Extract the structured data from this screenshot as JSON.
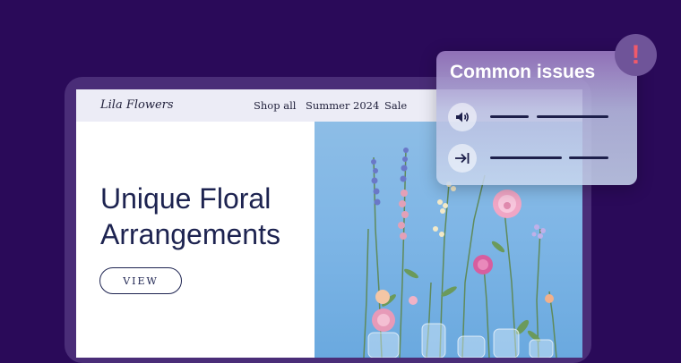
{
  "site": {
    "brand": "Lila Flowers",
    "nav": [
      "Shop all",
      "Summer 2024",
      "Sale"
    ],
    "hero_title": "Unique Floral Arrangements",
    "view_button": "VIEW"
  },
  "panel": {
    "title": "Common issues",
    "issues": [
      {
        "icon": "speaker-icon"
      },
      {
        "icon": "tab-arrow-icon"
      }
    ],
    "alert": "!"
  },
  "colors": {
    "background": "#2a0a59",
    "device": "#4a2d78",
    "heading": "#1d2350",
    "alert": "#f05a6a"
  }
}
